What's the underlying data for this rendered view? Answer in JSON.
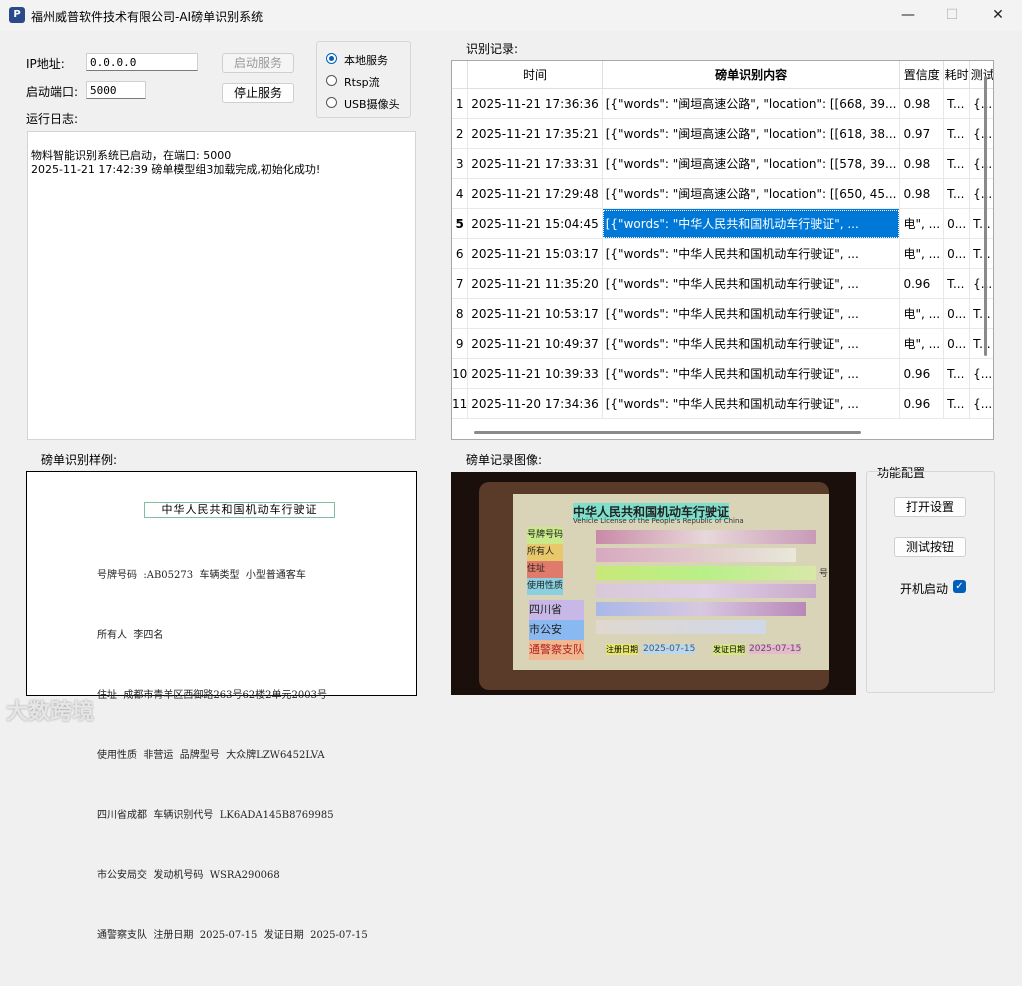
{
  "window": {
    "title": "福州威普软件技术有限公司-AI磅单识别系统",
    "app_icon_glyph": "P",
    "minimize_glyph": "—",
    "maximize_glyph": "☐",
    "close_glyph": "✕"
  },
  "server": {
    "ip_label": "IP地址:",
    "ip_value": "0.0.0.0",
    "port_label": "启动端口:",
    "port_value": "5000",
    "start_button": "启动服务",
    "stop_button": "停止服务"
  },
  "mode": {
    "options": [
      "本地服务",
      "Rtsp流",
      "USB摄像头"
    ],
    "selected": "本地服务"
  },
  "log": {
    "label": "运行日志:",
    "lines": [
      "物料智能识别系统已启动，在端口: 5000",
      "2025-11-21 17:42:39 磅单模型组3加载完成,初始化成功!"
    ]
  },
  "records": {
    "label": "识别记录:",
    "columns": [
      "时间",
      "磅单识别内容",
      "置信度",
      "耗时",
      "测试"
    ],
    "rows": [
      {
        "n": "1",
        "time": "2025-11-21 17:36:36",
        "content": "[{\"words\": \"闽垣高速公路\", \"location\": [[668, 39...",
        "conf": "0.98",
        "c4": "T...",
        "c5": "{..."
      },
      {
        "n": "2",
        "time": "2025-11-21 17:35:21",
        "content": "[{\"words\": \"闽垣高速公路\", \"location\": [[618, 38...",
        "conf": "0.97",
        "c4": "T...",
        "c5": "{..."
      },
      {
        "n": "3",
        "time": "2025-11-21 17:33:31",
        "content": "[{\"words\": \"闽垣高速公路\", \"location\": [[578, 39...",
        "conf": "0.98",
        "c4": "T...",
        "c5": "{..."
      },
      {
        "n": "4",
        "time": "2025-11-21 17:29:48",
        "content": "[{\"words\": \"闽垣高速公路\", \"location\": [[650, 45...",
        "conf": "0.98",
        "c4": "T...",
        "c5": "{..."
      },
      {
        "n": "5",
        "time": "2025-11-21 15:04:45",
        "content": "[{\"words\": \"中华人民共和国机动车行驶证\", ...",
        "conf": "电\", ...",
        "c4": "0...",
        "c5": "T..."
      },
      {
        "n": "6",
        "time": "2025-11-21 15:03:17",
        "content": "[{\"words\": \"中华人民共和国机动车行驶证\", ...",
        "conf": "电\", ...",
        "c4": "0...",
        "c5": "T..."
      },
      {
        "n": "7",
        "time": "2025-11-21 11:35:20",
        "content": "[{\"words\": \"中华人民共和国机动车行驶证\", ...",
        "conf": "0.96",
        "c4": "T...",
        "c5": "{..."
      },
      {
        "n": "8",
        "time": "2025-11-21 10:53:17",
        "content": "[{\"words\": \"中华人民共和国机动车行驶证\", ...",
        "conf": "电\", ...",
        "c4": "0...",
        "c5": "T..."
      },
      {
        "n": "9",
        "time": "2025-11-21 10:49:37",
        "content": "[{\"words\": \"中华人民共和国机动车行驶证\", ...",
        "conf": "电\", ...",
        "c4": "0...",
        "c5": "T..."
      },
      {
        "n": "10",
        "time": "2025-11-21 10:39:33",
        "content": "[{\"words\": \"中华人民共和国机动车行驶证\", ...",
        "conf": "0.96",
        "c4": "T...",
        "c5": "{..."
      },
      {
        "n": "11",
        "time": "2025-11-20 17:34:36",
        "content": "[{\"words\": \"中华人民共和国机动车行驶证\", ...",
        "conf": "0.96",
        "c4": "T...",
        "c5": "{..."
      }
    ],
    "selected_row": "5"
  },
  "sample": {
    "label": "磅单识别样例:",
    "title": "中华人民共和国机动车行驶证",
    "lines": [
      "号牌号码  :AB05273  车辆类型  小型普通客车",
      "所有人  李四名",
      "住址  成都市青羊区西御路263号62楼2单元2003号",
      "使用性质  非营运  品牌型号  大众牌LZW6452LVA",
      "四川省成都  车辆识别代号  LK6ADA145B8769985",
      "市公安局交  发动机号码  WSRA290068",
      "通警察支队  注册日期  2025-07-15  发证日期  2025-07-15"
    ]
  },
  "record_image": {
    "label": "磅单记录图像:",
    "title": "中华人民共和国机动车行驶证",
    "subtitle": "Vehicle License of the People's Republic of China",
    "left_labels": [
      "号牌号码",
      "所有人",
      "住址",
      "使用性质"
    ],
    "stamp_lines": [
      "四川省",
      "市公安",
      "通警察支队"
    ],
    "reg_label": "注册日期",
    "reg_date": "2025-07-15",
    "issue_label": "发证日期",
    "issue_date": "2025-07-15",
    "trailing": "号"
  },
  "func": {
    "label": "功能配置",
    "open_settings": "打开设置",
    "test_button": "测试按钮",
    "autostart_label": "开机启动",
    "autostart_checked": true,
    "check_glyph": "✓"
  },
  "watermark": "大数跨境"
}
